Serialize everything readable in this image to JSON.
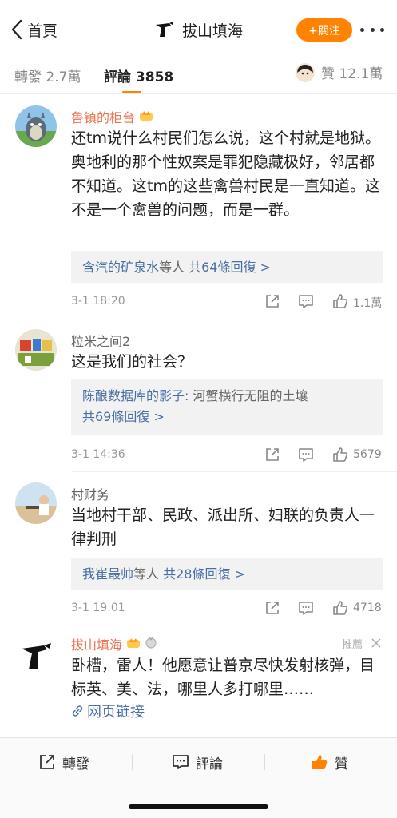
{
  "nav": {
    "back_label": "首頁",
    "title": "拔山填海",
    "follow_label": "+關注"
  },
  "tabs": {
    "repost": "轉發 2.7萬",
    "comment": "評論 3858",
    "like": "贊 12.1萬"
  },
  "comments": [
    {
      "username": "鲁镇的柜台",
      "badge": "crown-badge",
      "text": "还tm说什么村民们怎么说，这个村就是地狱。奥地利的那个性奴案是罪犯隐藏极好，邻居都不知道。这tm的这些禽兽村民是一直知道。这不是一个禽兽的问题，而是一群。",
      "reply_users": "含汽的矿泉水",
      "reply_suffix": "等人",
      "reply_count": "共64條回復 >",
      "time": "3-1 18:20",
      "likes": "1.1萬"
    },
    {
      "username": "粒米之间2",
      "text": "这是我们的社会？",
      "reply_user": "陈酿数据库的影子",
      "reply_quote": ": 河蟹横行无阻的土壤",
      "reply_count": "共69條回復 >",
      "time": "3-1 14:36",
      "likes": "5679"
    },
    {
      "username": "村财务",
      "text": "当地村干部、民政、派出所、妇联的负责人一律判刑",
      "reply_users": "我崔最帅",
      "reply_suffix": "等人",
      "reply_count": "共28條回復 >",
      "time": "3-1 19:01",
      "likes": "4718"
    },
    {
      "username": "拔山填海",
      "badges": [
        "crown-badge",
        "medal-badge"
      ],
      "recommend": "推薦",
      "text": "卧槽，雷人！他愿意让普京尽快发射核弹，目标英、美、法，哪里人多打哪里……",
      "link": "网页链接"
    }
  ],
  "bottom": {
    "repost": "轉發",
    "comment": "評論",
    "like": "贊"
  },
  "colors": {
    "accent": "#ff8200",
    "link": "#4a6fa5",
    "username_orange": "#eb7350"
  }
}
